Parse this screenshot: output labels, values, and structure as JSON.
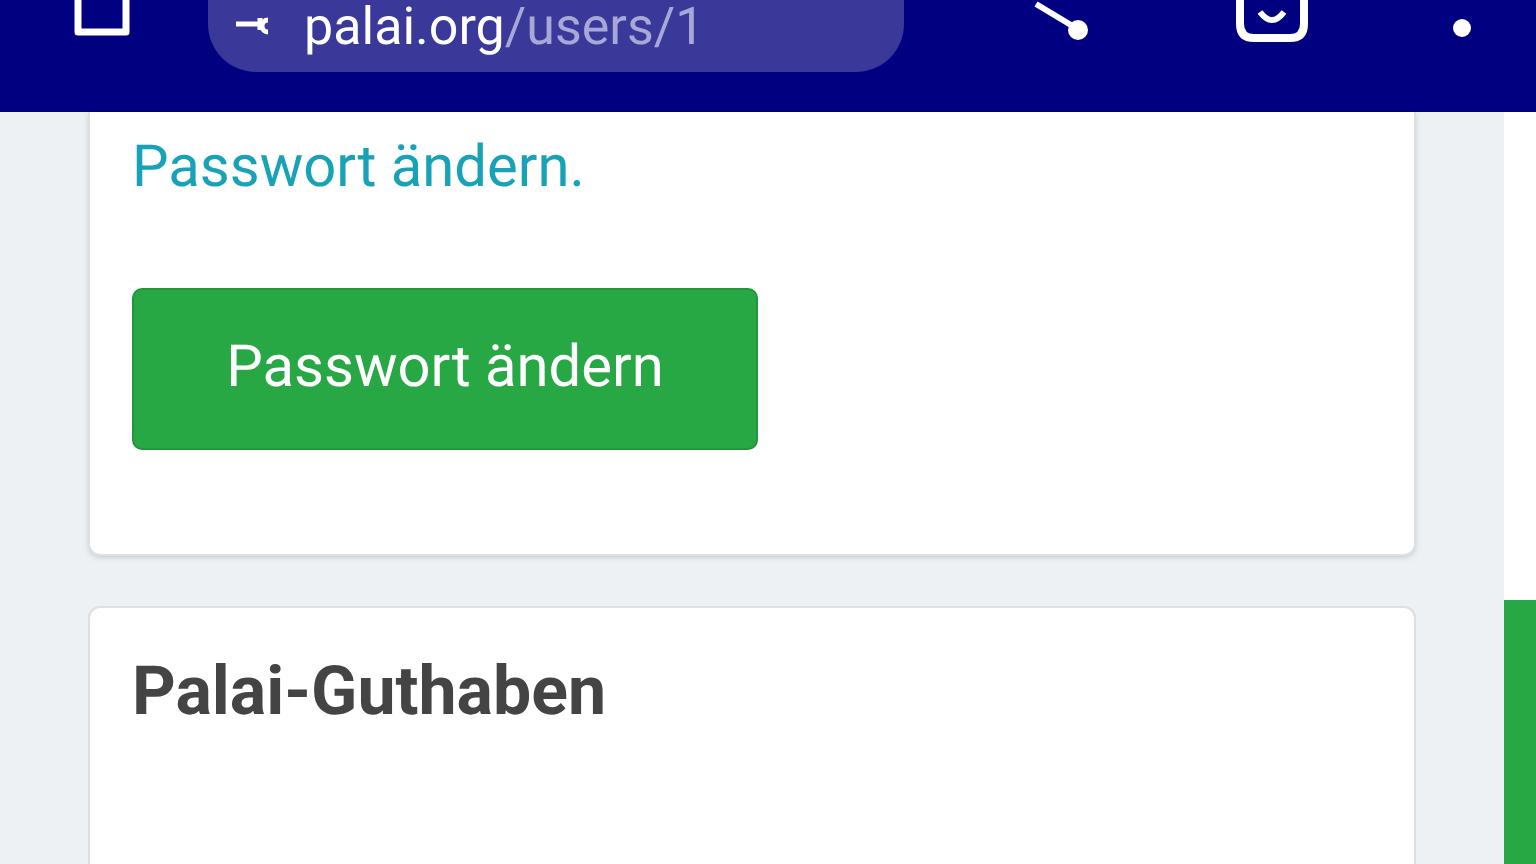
{
  "browser_bar": {
    "url_host": "palai.org",
    "url_path": "/users/1"
  },
  "password_card": {
    "link": "Passwort ändern.",
    "button": "Passwort ändern"
  },
  "balance_card": {
    "title": "Palai-Guthaben"
  }
}
